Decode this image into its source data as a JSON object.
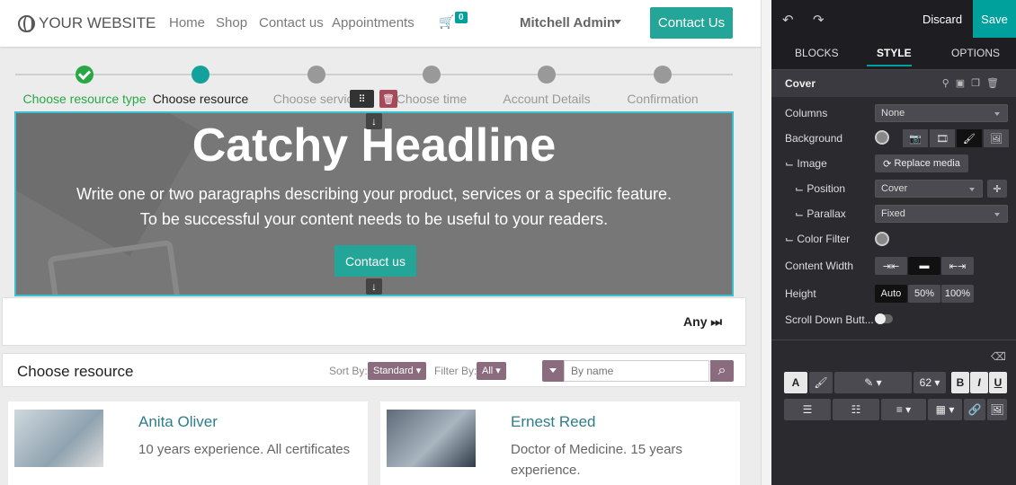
{
  "site": {
    "logo_text": "YOUR WEBSITE",
    "nav": [
      "Home",
      "Shop",
      "Contact us",
      "Appointments"
    ],
    "cart_count": "0",
    "user": "Mitchell Admin",
    "contact_button": "Contact Us"
  },
  "steps": [
    {
      "label": "Choose resource type",
      "state": "done"
    },
    {
      "label": "Choose resource",
      "state": "active"
    },
    {
      "label": "Choose service",
      "state": "todo"
    },
    {
      "label": "Choose time",
      "state": "todo"
    },
    {
      "label": "Account Details",
      "state": "todo"
    },
    {
      "label": "Confirmation",
      "state": "todo"
    }
  ],
  "cover": {
    "headline": "Catchy Headline",
    "line1": "Write one or two paragraphs describing your product, services or a specific feature.",
    "line2": "To be successful your content needs to be useful to your readers.",
    "button": "Contact us"
  },
  "any_label": "Any",
  "resource_bar": {
    "title": "Choose resource",
    "sort_label": "Sort By:",
    "sort_value": "Standard",
    "filter_label": "Filter By:",
    "filter_value": "All",
    "search_placeholder": "By name"
  },
  "resources": [
    {
      "name": "Anita Oliver",
      "desc": "10 years experience. All certificates"
    },
    {
      "name": "Ernest Reed",
      "desc": "Doctor of Medicine. 15 years experience."
    }
  ],
  "editor": {
    "discard": "Discard",
    "save": "Save",
    "tabs": [
      "BLOCKS",
      "STYLE",
      "OPTIONS"
    ],
    "section": "Cover",
    "rows": {
      "columns": "Columns",
      "columns_value": "None",
      "background": "Background",
      "image": "⌙ Image",
      "replace_media": "Replace media",
      "position": "⌙ Position",
      "position_value": "Cover",
      "parallax": "⌙ Parallax",
      "parallax_value": "Fixed",
      "color_filter": "⌙ Color Filter",
      "content_width": "Content Width",
      "height": "Height",
      "height_auto": "Auto",
      "height_50": "50%",
      "height_100": "100%",
      "scroll_down": "Scroll Down Butt..."
    },
    "font_size": "62",
    "colors": {
      "accent": "#00a09d",
      "panel": "#2b2b2f"
    }
  }
}
